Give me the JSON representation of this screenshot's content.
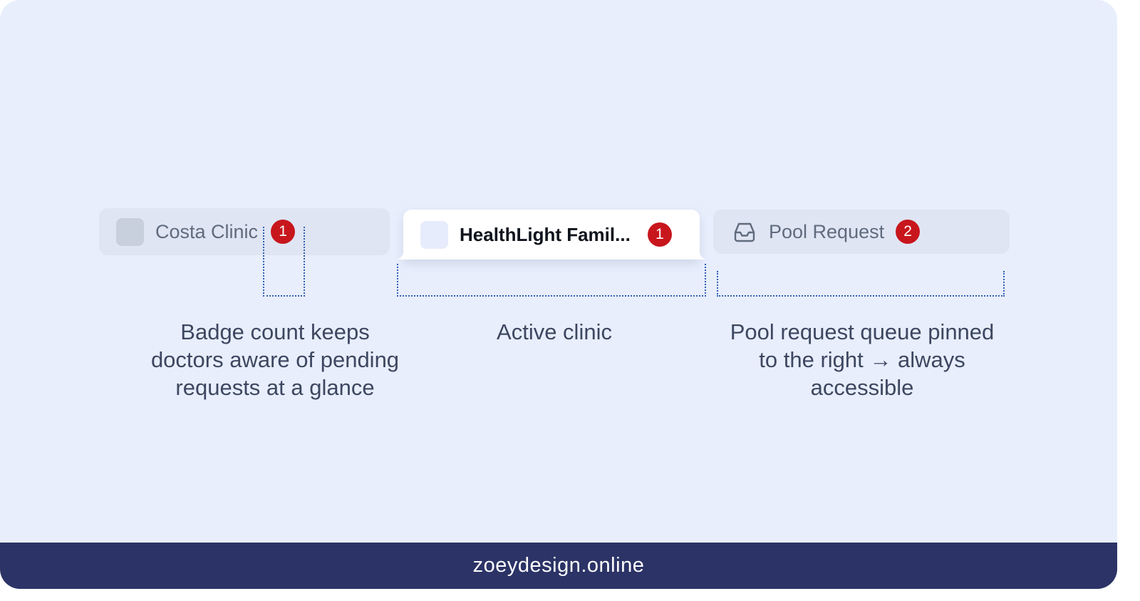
{
  "tabs": [
    {
      "label": "Costa Clinic",
      "badge": "1",
      "state": "inactive",
      "logo": "clinic-logo-placeholder"
    },
    {
      "label": "HealthLight Famil...",
      "badge": "1",
      "state": "active",
      "logo": "clinic-logo-placeholder"
    },
    {
      "label": "Pool Request",
      "badge": "2",
      "state": "inactive",
      "icon": "inbox-icon"
    }
  ],
  "annotations": {
    "badge_count": [
      "Badge count keeps",
      "doctors aware of pending",
      "requests at a glance"
    ],
    "active_clinic": [
      "Active clinic"
    ],
    "pool_request": [
      "Pool request queue pinned",
      "to the right → always",
      "accessible"
    ]
  },
  "footer": {
    "text": "zoeydesign.online"
  },
  "colors": {
    "background": "#e8eefc",
    "tab_inactive": "#dfe5f3",
    "badge": "#c8161d",
    "annotation_line": "#2f5fb3",
    "footer": "#2c3366"
  }
}
